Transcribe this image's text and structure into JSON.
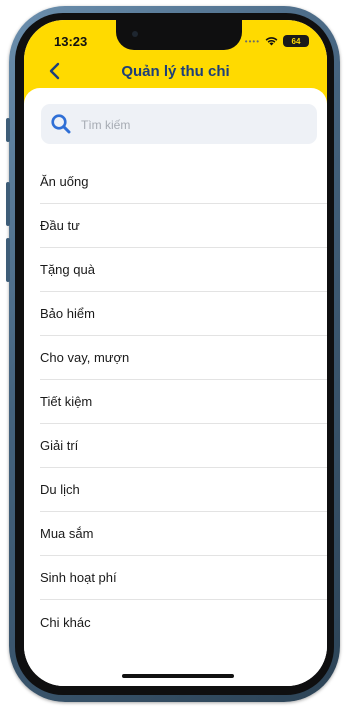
{
  "status_bar": {
    "time": "13:23",
    "battery": "64"
  },
  "header": {
    "title": "Quản lý thu chi"
  },
  "search": {
    "placeholder": "Tìm kiếm"
  },
  "categories": [
    "Ăn uống",
    "Đầu tư",
    "Tặng quà",
    "Bảo hiểm",
    "Cho vay, mượn",
    "Tiết kiệm",
    "Giải trí",
    "Du lịch",
    "Mua sắm",
    "Sinh hoạt phí",
    "Chi khác"
  ],
  "colors": {
    "header_bg": "#FFDA00",
    "title": "#1d3f7a",
    "accent": "#2f6fd6"
  }
}
